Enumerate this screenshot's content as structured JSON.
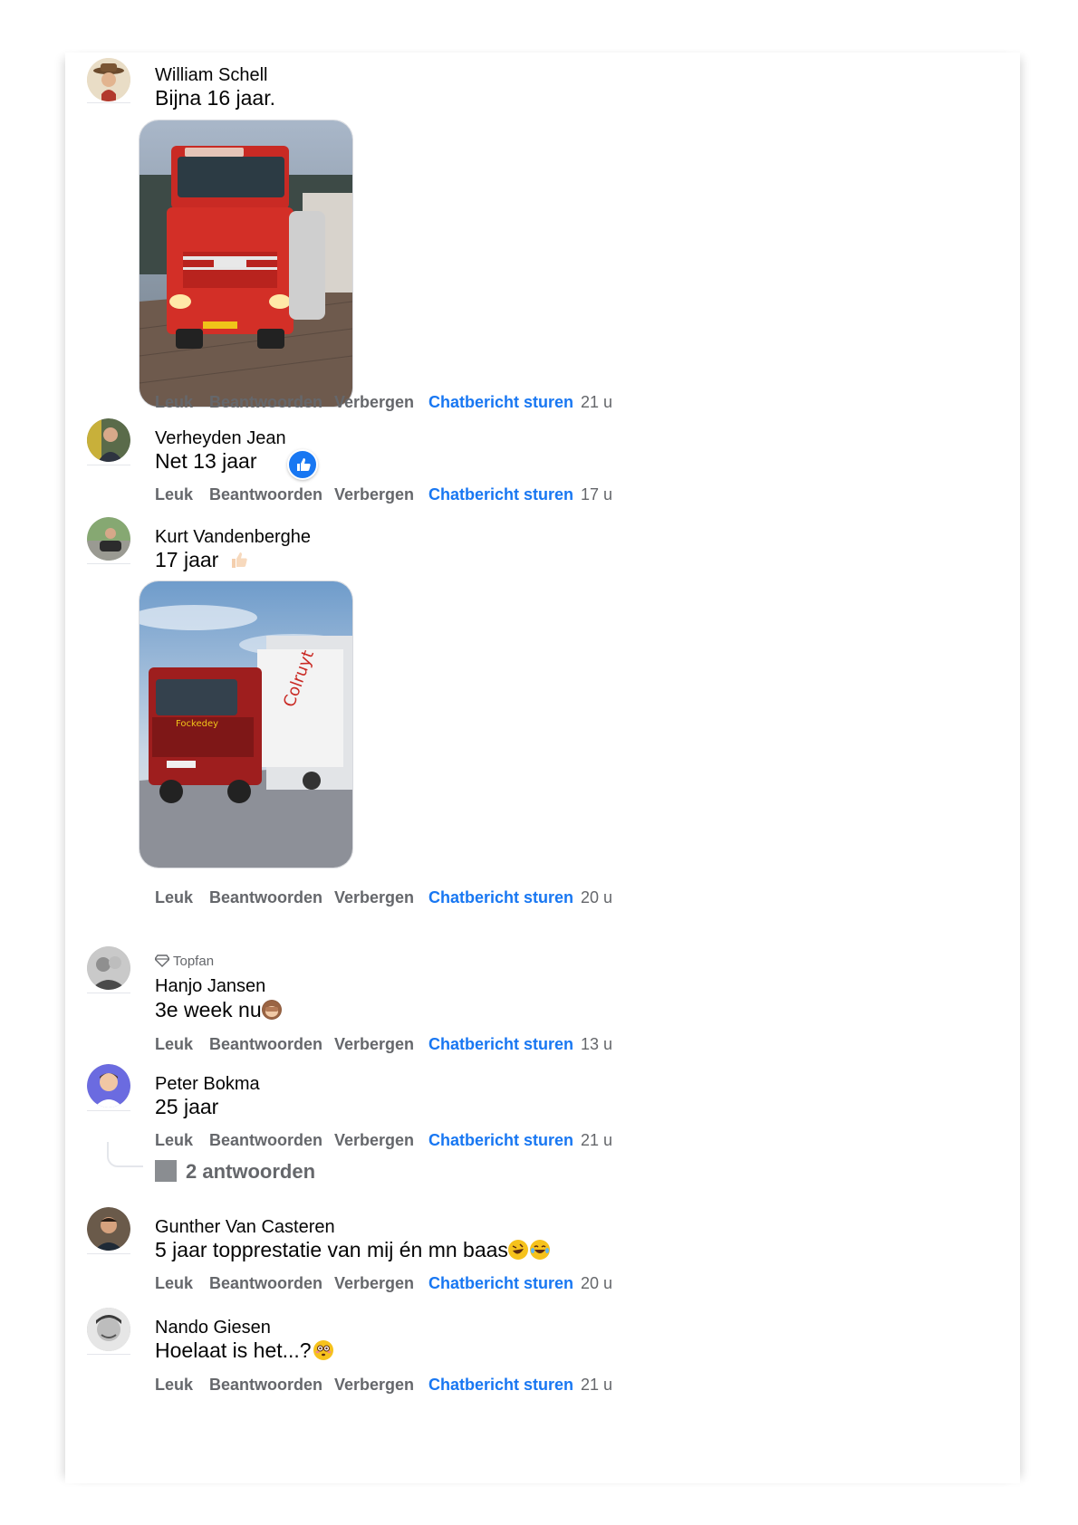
{
  "comments": [
    {
      "author": "William Schell",
      "text": "Bijna 16 jaar.",
      "time": "21 u"
    },
    {
      "author": "Verheyden Jean",
      "text": "Net 13 jaar",
      "time": "17 u",
      "reaction_icon": "like-reaction-icon"
    },
    {
      "author": "Kurt Vandenberghe",
      "text": "17 jaar",
      "time": "20 u",
      "emoji": "thumbs-up-emoji"
    },
    {
      "badge": "Topfan",
      "author": "Hanjo Jansen",
      "text": "3e week nu",
      "time": "13 u",
      "emoji": "see-no-evil-monkey-emoji"
    },
    {
      "author": "Peter Bokma",
      "text": "25 jaar",
      "time": "21 u",
      "replies_label": "2 antwoorden"
    },
    {
      "author": "Gunther Van Casteren",
      "text": "5 jaar topprestatie van mij én mn baas",
      "time": "20 u",
      "emoji": "rolling-laughing-emoji"
    },
    {
      "author": "Nando Giesen",
      "text": "Hoelaat is het...?",
      "time": "21 u",
      "emoji": "flushed-face-emoji"
    }
  ],
  "actions": {
    "like": "Leuk",
    "reply": "Beantwoorden",
    "hide": "Verbergen",
    "message": "Chatbericht sturen"
  },
  "colors": {
    "link_blue": "#1877f2",
    "action_grey": "#65676b",
    "text": "#050505"
  }
}
